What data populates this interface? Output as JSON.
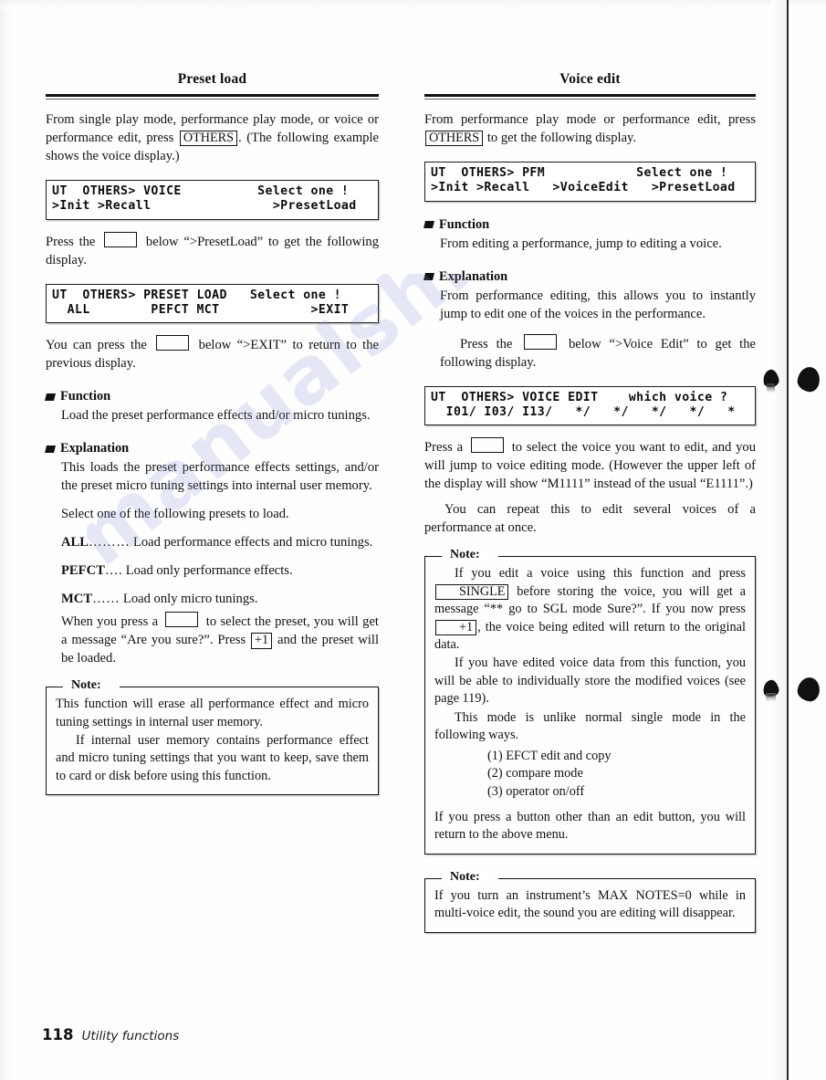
{
  "page": {
    "number": "118",
    "section_label": "Utility functions",
    "watermark": "manualshive.c"
  },
  "left": {
    "title": "Preset load",
    "intro": {
      "before_key": "From single play mode, performance play mode, or voice or performance edit, press ",
      "key": "OTHERS",
      "after_key": ". (The following example shows the voice display.)"
    },
    "lcd1": {
      "line1": "UT  OTHERS> VOICE          Select one !",
      "line2": ">Init >Recall                >PresetLoad"
    },
    "press_preset": {
      "before": "Press the ",
      "after": " below “>PresetLoad” to get the following display."
    },
    "lcd2": {
      "line1": "UT  OTHERS> PRESET LOAD   Select one !",
      "line2": "  ALL        PEFCT MCT            >EXIT"
    },
    "press_exit": {
      "before": "You can press the ",
      "after": " below “>EXIT” to return to the previous display."
    },
    "function": {
      "heading": "Function",
      "text": "Load the preset performance effects and/or micro tunings."
    },
    "explanation": {
      "heading": "Explanation",
      "p1": "This loads the preset performance effects settings, and/or the preset micro tuning settings into internal user memory.",
      "p2": "Select one of the following presets to load."
    },
    "presets": [
      {
        "term": "ALL",
        "dots": "………",
        "desc": "Load performance effects and micro tunings."
      },
      {
        "term": "PEFCT",
        "dots": "….",
        "desc": "Load only performance effects."
      },
      {
        "term": "MCT",
        "dots": "……",
        "desc": "Load only micro tunings."
      }
    ],
    "confirm": {
      "before_key1": "When you press a ",
      "mid": " to select the preset, you will get a message “Are you sure?”. Press ",
      "key2": "+1",
      "after": " and the preset will be loaded."
    },
    "note": {
      "label": "Note:",
      "p1": "This function will erase all performance effect and micro tuning settings in internal user memory.",
      "p2": "If internal user memory contains performance effect and micro tuning settings that you want to keep, save them to card or disk before using this function."
    }
  },
  "right": {
    "title": "Voice edit",
    "intro": {
      "before_key": "From performance play mode or performance edit, press ",
      "key": "OTHERS",
      "after_key": " to get the following display."
    },
    "lcd1": {
      "line1": "UT  OTHERS> PFM            Select one !",
      "line2": ">Init >Recall   >VoiceEdit   >PresetLoad"
    },
    "function": {
      "heading": "Function",
      "text": "From editing a performance, jump to editing a voice."
    },
    "explanation": {
      "heading": "Explanation",
      "p1": "From performance editing, this allows you to instantly jump to edit one of the voices in the performance.",
      "p2_before": "Press the ",
      "p2_after": " below “>Voice Edit” to get the following display."
    },
    "lcd2": {
      "line1": "UT  OTHERS> VOICE EDIT    which voice ?",
      "line2": "  I01/ I03/ I13/   */   */   */   */   *"
    },
    "after_lcd2": {
      "before_key": "Press a ",
      "after_key": " to select the voice you want to edit, and you will jump to voice editing mode. (However the upper left of the display will show “M1111” instead of the usual “E1111”.)",
      "p2": "You can repeat this to edit several voices of a performance at once."
    },
    "note1": {
      "label": "Note:",
      "p1_a": "If you edit a voice using this function and press ",
      "p1_key1": "SINGLE",
      "p1_b": " before storing the voice, you will get a message “** go to SGL mode Sure?”. If you now press ",
      "p1_key2": "+1",
      "p1_c": ", the voice being edited will return to the original data.",
      "p2": "If you have edited voice data from this function, you will be able to individually store the modified voices (see page 119).",
      "p3": "This mode is unlike normal single mode in the following ways.",
      "list": [
        "(1) EFCT edit and copy",
        "(2) compare mode",
        "(3) operator on/off"
      ],
      "p4": "If you press a button other than an edit button, you will return to the above menu."
    },
    "note2": {
      "label": "Note:",
      "p1": "If you turn an instrument’s MAX NOTES=0 while in multi-voice edit, the sound you are editing will disappear."
    }
  }
}
